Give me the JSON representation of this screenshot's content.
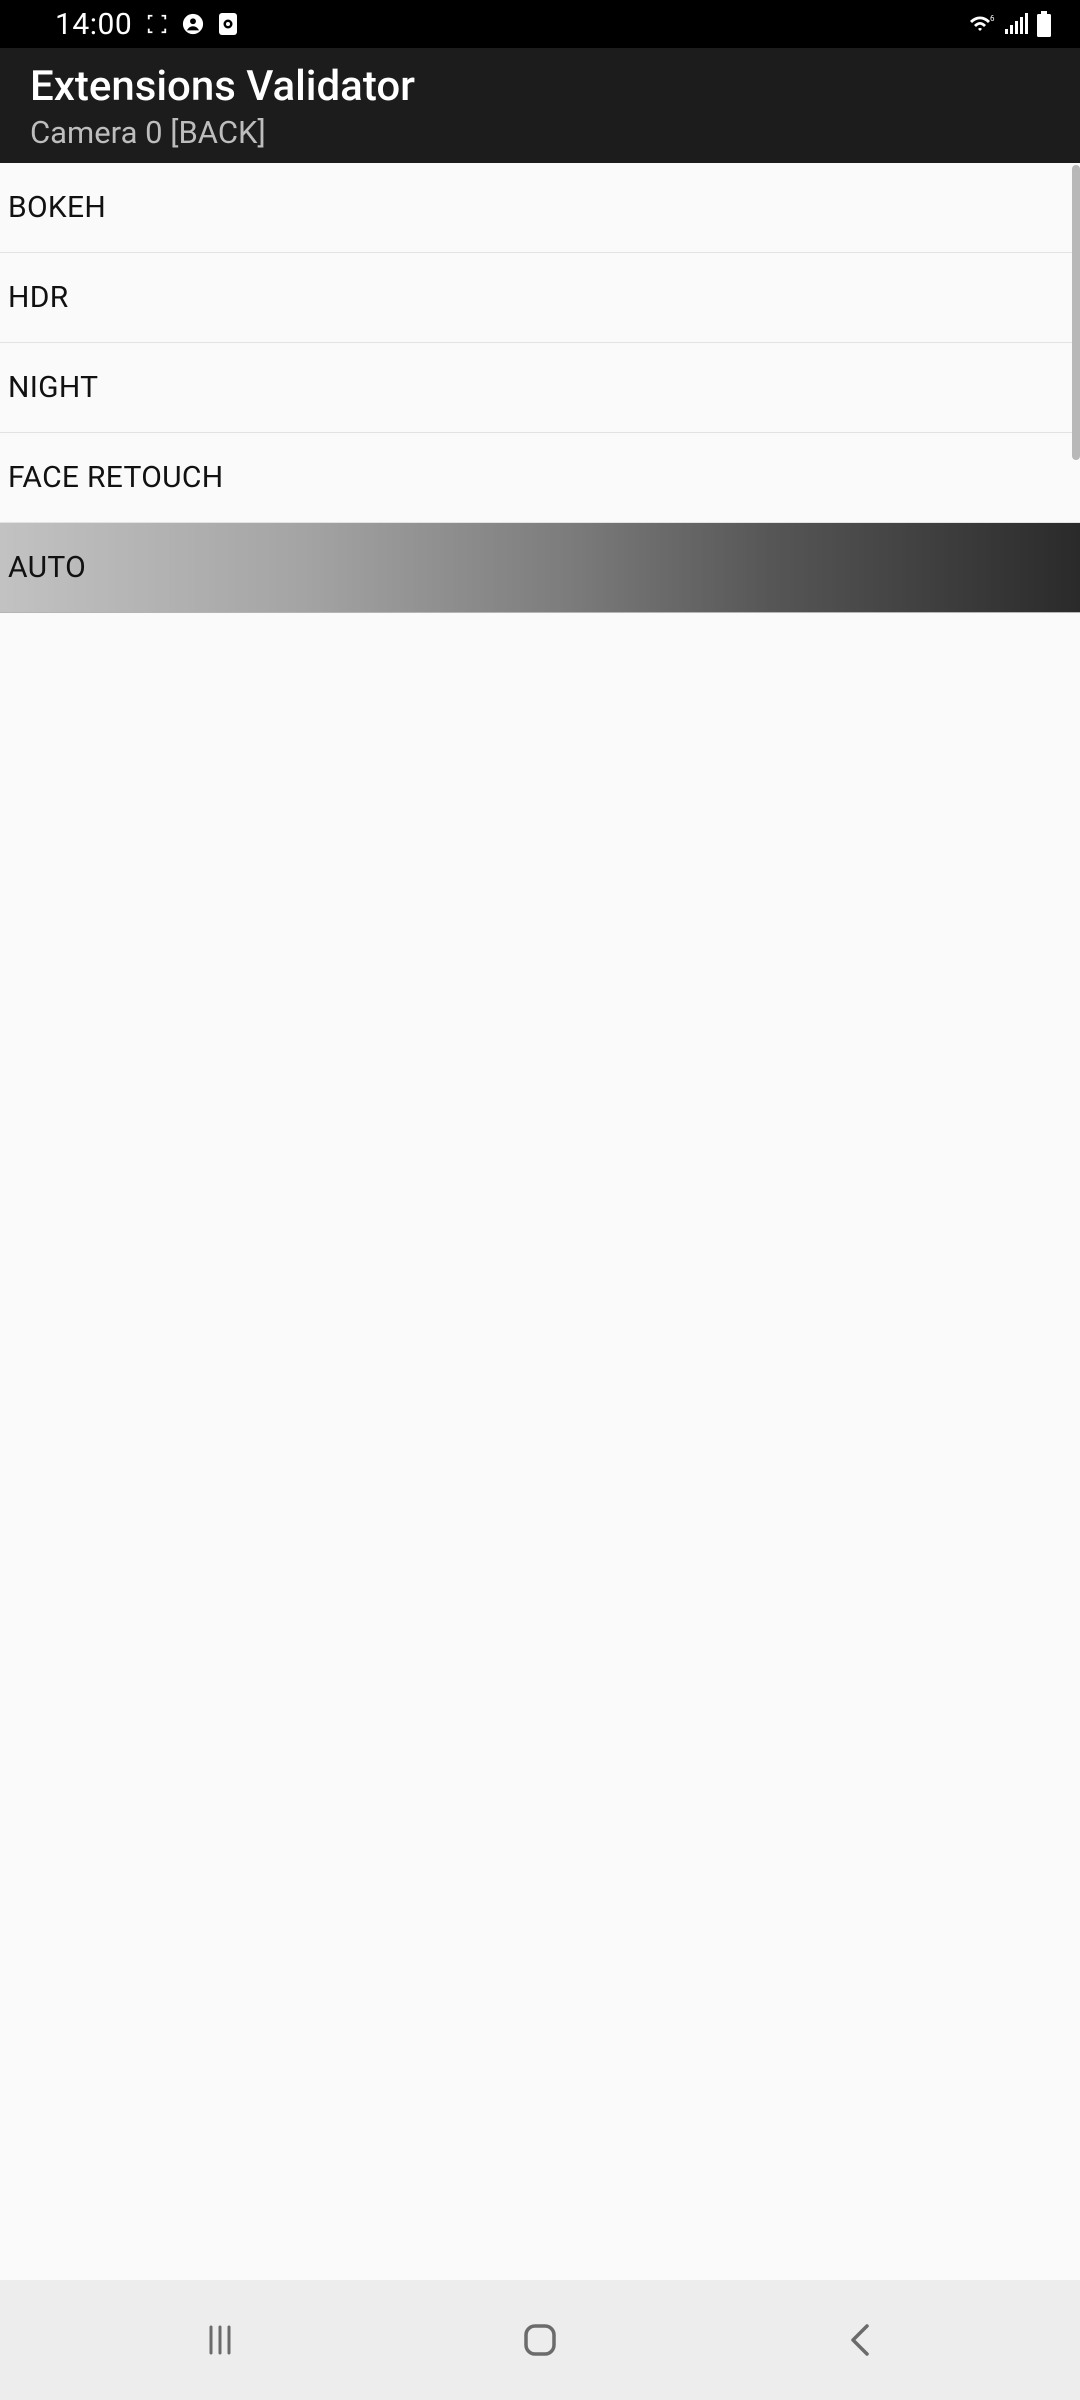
{
  "status": {
    "time": "14:00"
  },
  "header": {
    "title": "Extensions Validator",
    "subtitle": "Camera 0 [BACK]"
  },
  "list": {
    "items": [
      {
        "label": "BOKEH",
        "selected": false
      },
      {
        "label": "HDR",
        "selected": false
      },
      {
        "label": "NIGHT",
        "selected": false
      },
      {
        "label": "FACE RETOUCH",
        "selected": false
      },
      {
        "label": "AUTO",
        "selected": true
      }
    ]
  }
}
